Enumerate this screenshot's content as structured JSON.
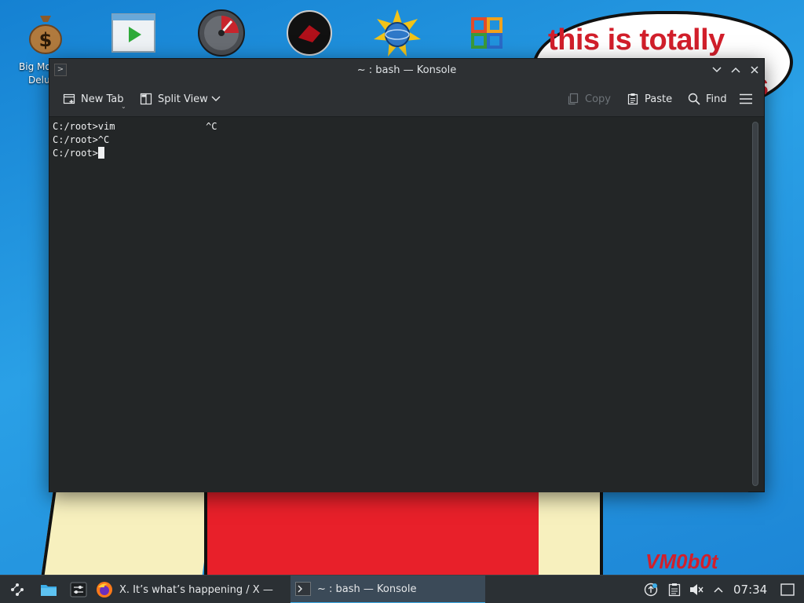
{
  "desktop": {
    "bubble_text": "this is totally",
    "bubble_tail_text": "s",
    "signature": "VM0b0t",
    "icon_label_line1": "Big Mo",
    "icon_label_line2": "Delu"
  },
  "window": {
    "title": "~ : bash — Konsole"
  },
  "toolbar": {
    "new_tab": "New Tab",
    "split_view": "Split View",
    "copy": "Copy",
    "paste": "Paste",
    "find": "Find"
  },
  "terminal": {
    "lines": [
      "C:/root>vim                ^C",
      "C:/root>^C",
      "C:/root>"
    ]
  },
  "taskbar": {
    "tasks": [
      {
        "label": "X. It’s what’s happening / X —"
      },
      {
        "label": "~ : bash — Konsole"
      }
    ],
    "clock": "07:34"
  },
  "colors": {
    "accent": "#3daee9",
    "terminal_bg": "#232627",
    "bubble_text": "#d21f2b"
  }
}
